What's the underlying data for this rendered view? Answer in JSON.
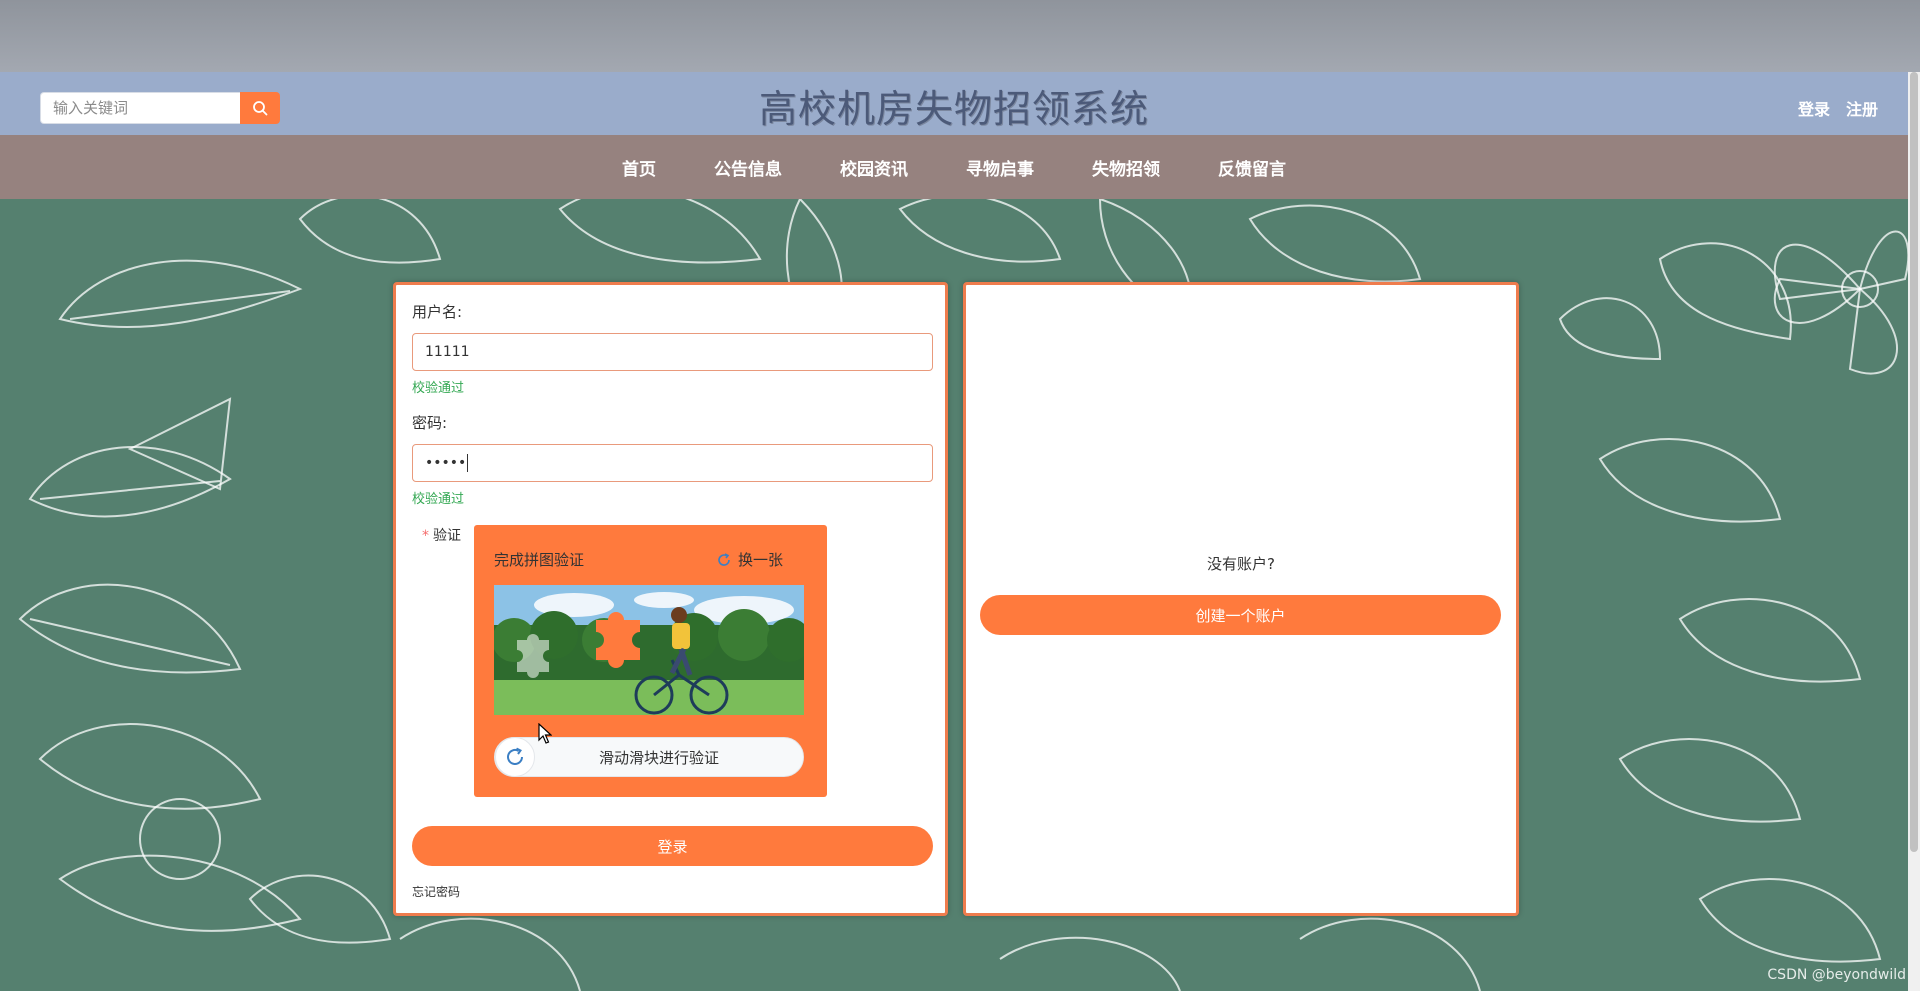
{
  "header": {
    "search_placeholder": "输入关键词",
    "title": "高校机房失物招领系统",
    "login_link": "登录",
    "register_link": "注册"
  },
  "nav": {
    "items": [
      "首页",
      "公告信息",
      "校园资讯",
      "寻物启事",
      "失物招领",
      "反馈留言"
    ]
  },
  "login_form": {
    "username_label": "用户名:",
    "username_value": "11111",
    "username_valid": "校验通过",
    "password_label": "密码:",
    "password_value": "•••••",
    "password_valid": "校验通过",
    "verify_label": "验证",
    "captcha_title": "完成拼图验证",
    "captcha_refresh": "换一张",
    "slider_text": "滑动滑块进行验证",
    "login_button": "登录",
    "forgot_link": "忘记密码"
  },
  "register_panel": {
    "prompt": "没有账户?",
    "create_button": "创建一个账户"
  },
  "watermark": "CSDN @beyondwild",
  "colors": {
    "accent": "#ff7a3d",
    "header_bg": "#9aaccb",
    "nav_bg": "#96827f",
    "valid": "#34a853",
    "background": "#55806f"
  }
}
